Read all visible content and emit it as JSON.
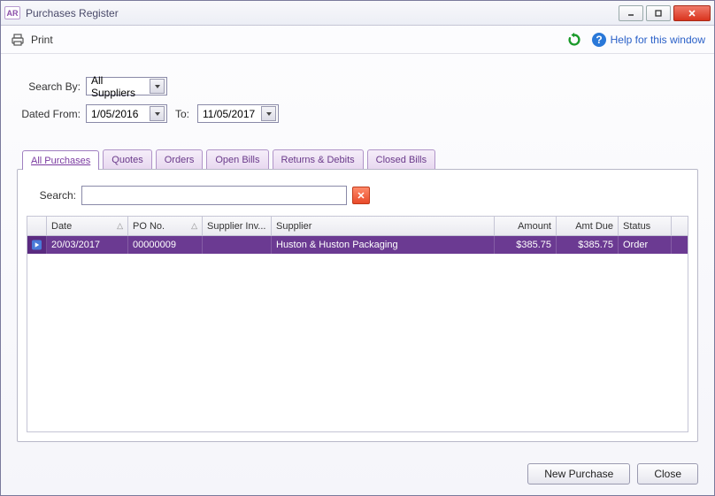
{
  "window": {
    "title": "Purchases Register",
    "badge": "AR"
  },
  "toolbar": {
    "print_label": "Print",
    "help_label": "Help for this window"
  },
  "filters": {
    "search_by_label": "Search By:",
    "search_by_value": "All Suppliers",
    "dated_from_label": "Dated From:",
    "dated_from_value": "1/05/2016",
    "to_label": "To:",
    "dated_to_value": "11/05/2017"
  },
  "tabs": [
    {
      "label": "All Purchases",
      "active": true
    },
    {
      "label": "Quotes",
      "active": false
    },
    {
      "label": "Orders",
      "active": false
    },
    {
      "label": "Open Bills",
      "active": false
    },
    {
      "label": "Returns & Debits",
      "active": false
    },
    {
      "label": "Closed Bills",
      "active": false
    }
  ],
  "search": {
    "label": "Search:",
    "value": ""
  },
  "grid": {
    "columns": {
      "date": "Date",
      "po_no": "PO No.",
      "supplier_inv": "Supplier Inv...",
      "supplier": "Supplier",
      "amount": "Amount",
      "amt_due": "Amt Due",
      "status": "Status"
    },
    "rows": [
      {
        "date": "20/03/2017",
        "po_no": "00000009",
        "supplier_inv": "",
        "supplier": "Huston & Huston Packaging",
        "amount": "$385.75",
        "amt_due": "$385.75",
        "status": "Order"
      }
    ]
  },
  "footer": {
    "new_purchase": "New Purchase",
    "close": "Close"
  }
}
